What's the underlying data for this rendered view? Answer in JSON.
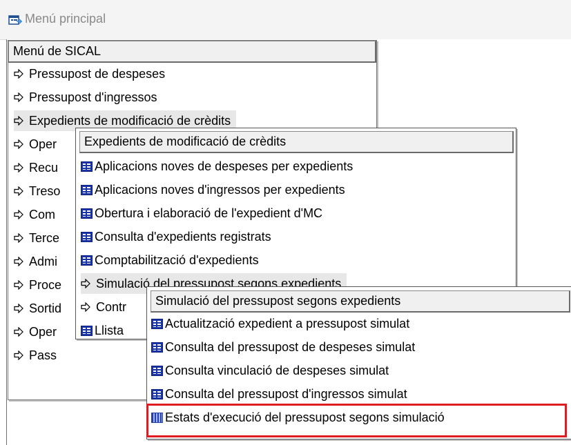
{
  "window": {
    "title": "Menú principal",
    "app_icon": "window-app-icon"
  },
  "main_menu": {
    "header": "Menú de SICAL",
    "items": [
      {
        "label": "Pressupost de despeses",
        "icon": "arrow-right-icon"
      },
      {
        "label": "Pressupost d'ingressos",
        "icon": "arrow-right-icon"
      },
      {
        "label": "Expedients de modificació de crèdits",
        "icon": "arrow-right-icon",
        "highlighted": true
      },
      {
        "label": "Oper",
        "icon": "arrow-right-icon"
      },
      {
        "label": "Recu",
        "icon": "arrow-right-icon"
      },
      {
        "label": "Treso",
        "icon": "arrow-right-icon"
      },
      {
        "label": "Com",
        "icon": "arrow-right-icon"
      },
      {
        "label": "Terce",
        "icon": "arrow-right-icon"
      },
      {
        "label": "Admi",
        "icon": "arrow-right-icon"
      },
      {
        "label": "Proce",
        "icon": "arrow-right-icon"
      },
      {
        "label": "Sortid",
        "icon": "arrow-right-icon"
      },
      {
        "label": "Oper",
        "icon": "arrow-right-icon"
      },
      {
        "label": "Pass",
        "icon": "arrow-right-icon"
      }
    ]
  },
  "submenu_expedients": {
    "header": "Expedients de modificació de crèdits",
    "items": [
      {
        "label": "Aplicacions noves de despeses per expedients",
        "icon": "form-icon"
      },
      {
        "label": "Aplicacions noves d'ingressos per expedients",
        "icon": "form-icon"
      },
      {
        "label": "Obertura i elaboració de l'expedient d'MC",
        "icon": "form-icon"
      },
      {
        "label": "Consulta d'expedients registrats",
        "icon": "form-icon"
      },
      {
        "label": "Comptabilització d'expedients",
        "icon": "form-icon"
      },
      {
        "label": "Simulació del pressupost segons expedients",
        "icon": "arrow-right-icon",
        "highlighted": true
      },
      {
        "label": "Contr",
        "icon": "arrow-right-icon"
      },
      {
        "label": "Llista",
        "icon": "form-icon"
      }
    ]
  },
  "submenu_simulacio": {
    "header": "Simulació del pressupost segons expedients",
    "items": [
      {
        "label": "Actualització expedient a pressupost simulat",
        "icon": "form-icon"
      },
      {
        "label": "Consulta del pressupost de despeses simulat",
        "icon": "form-icon"
      },
      {
        "label": "Consulta vinculació de despeses simulat",
        "icon": "form-icon"
      },
      {
        "label": "Consulta del pressupost d'ingressos simulat",
        "icon": "form-icon"
      },
      {
        "label": "Estats d'execució del pressupost segons simulació",
        "icon": "grid-report-icon",
        "outlined": true
      }
    ],
    "outline_color": "#e01b22"
  }
}
